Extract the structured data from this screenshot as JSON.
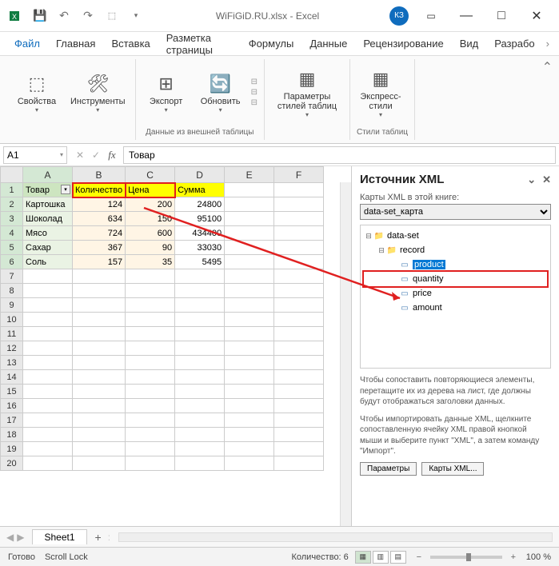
{
  "title": "WiFiGiD.RU.xlsx - Excel",
  "avatar": "КЗ",
  "menu": [
    "Файл",
    "Главная",
    "Вставка",
    "Разметка страницы",
    "Формулы",
    "Данные",
    "Рецензирование",
    "Вид",
    "Разрабо"
  ],
  "ribbon": {
    "g1": {
      "b1": "Свойства",
      "b2": "Инструменты",
      "label": ""
    },
    "g2": {
      "b1": "Экспорт",
      "b2": "Обновить",
      "label": "Данные из внешней таблицы"
    },
    "g3": {
      "b1": "Параметры\nстилей таблиц",
      "label": ""
    },
    "g4": {
      "b1": "Экспресс-\nстили",
      "label": "Стили таблиц"
    }
  },
  "namebox": "A1",
  "formula": "Товар",
  "cols": [
    "A",
    "B",
    "C",
    "D",
    "E",
    "F"
  ],
  "headers": {
    "a": "Товар",
    "b": "Количество",
    "c": "Цена",
    "d": "Сумма"
  },
  "rows": [
    {
      "a": "Картошка",
      "b": "124",
      "c": "200",
      "d": "24800"
    },
    {
      "a": "Шоколад",
      "b": "634",
      "c": "150",
      "d": "95100"
    },
    {
      "a": "Мясо",
      "b": "724",
      "c": "600",
      "d": "434400"
    },
    {
      "a": "Сахар",
      "b": "367",
      "c": "90",
      "d": "33030"
    },
    {
      "a": "Соль",
      "b": "157",
      "c": "35",
      "d": "5495"
    }
  ],
  "xml": {
    "title": "Источник XML",
    "sub": "Карты XML в этой книге:",
    "map": "data-set_карта",
    "tree": {
      "root": "data-set",
      "rec": "record",
      "leaves": [
        "product",
        "quantity",
        "price",
        "amount"
      ]
    },
    "help1": "Чтобы сопоставить повторяющиеся элементы, перетащите их из дерева на лист, где должны будут отображаться заголовки данных.",
    "help2": "Чтобы импортировать данные XML, щелкните сопоставленную ячейку XML правой кнопкой мыши и выберите пункт \"XML\", а затем команду \"Импорт\".",
    "btn1": "Параметры",
    "btn2": "Карты XML..."
  },
  "sheet_tab": "Sheet1",
  "status": {
    "ready": "Готово",
    "scroll": "Scroll Lock",
    "count": "Количество: 6",
    "zoom": "100 %"
  }
}
